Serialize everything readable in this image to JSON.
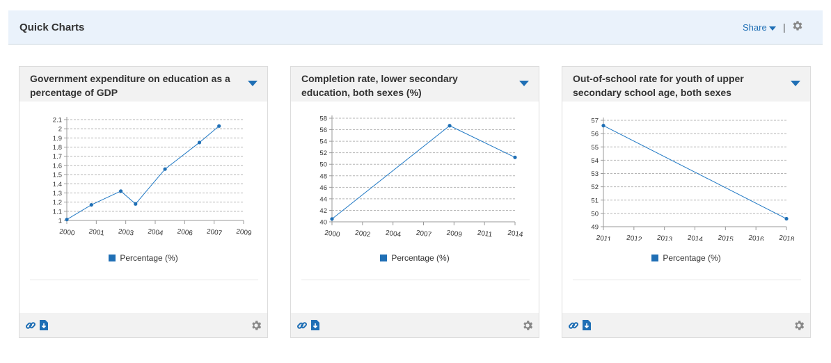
{
  "header": {
    "title": "Quick Charts",
    "share_label": "Share",
    "separator": "|"
  },
  "colors": {
    "accent": "#1f6fb5",
    "header_bg": "#eaf2fb",
    "card_header_bg": "#f2f2f2"
  },
  "cards": [
    {
      "title": "Government expenditure on education as a percentage of GDP",
      "legend": "Percentage (%)",
      "chart_data": {
        "type": "line",
        "x": [
          2000,
          2001,
          2003,
          2004,
          2006,
          2007,
          2009
        ],
        "x_positions": [
          2000,
          2001.25,
          2002.75,
          2003.5,
          2005,
          2006.75,
          2007.75
        ],
        "xticks": [
          "2000",
          "2001",
          "2003",
          "2004",
          "2006",
          "2007",
          "2009"
        ],
        "yticks": [
          "1",
          "1.1",
          "1.2",
          "1.3",
          "1.4",
          "1.5",
          "1.6",
          "1.7",
          "1.8",
          "1.9",
          "2",
          "2.1"
        ],
        "ylim": [
          1,
          2.1
        ],
        "series": [
          {
            "values": [
              1.01,
              1.17,
              1.32,
              1.18,
              1.56,
              1.85,
              2.03
            ]
          }
        ]
      }
    },
    {
      "title": "Completion rate, lower secondary education, both sexes (%)",
      "legend": "Percentage (%)",
      "chart_data": {
        "type": "line",
        "x": [
          2000,
          2009,
          2014
        ],
        "xticks": [
          "2000",
          "2002",
          "2004",
          "2007",
          "2009",
          "2011",
          "2014"
        ],
        "yticks": [
          "40",
          "42",
          "44",
          "46",
          "48",
          "50",
          "52",
          "54",
          "56",
          "58"
        ],
        "ylim": [
          40,
          58
        ],
        "series": [
          {
            "values": [
              40.5,
              56.7,
              51.2
            ]
          }
        ]
      }
    },
    {
      "title": "Out-of-school rate for youth of upper secondary school age, both sexes",
      "legend": "Percentage (%)",
      "chart_data": {
        "type": "line",
        "x": [
          2011,
          2018
        ],
        "xticks": [
          "2011",
          "2012",
          "2013",
          "2014",
          "2015",
          "2016",
          "2018"
        ],
        "yticks": [
          "49",
          "50",
          "51",
          "52",
          "53",
          "54",
          "55",
          "56",
          "57"
        ],
        "ylim": [
          49,
          57
        ],
        "series": [
          {
            "values": [
              56.6,
              49.6
            ]
          }
        ]
      }
    }
  ]
}
